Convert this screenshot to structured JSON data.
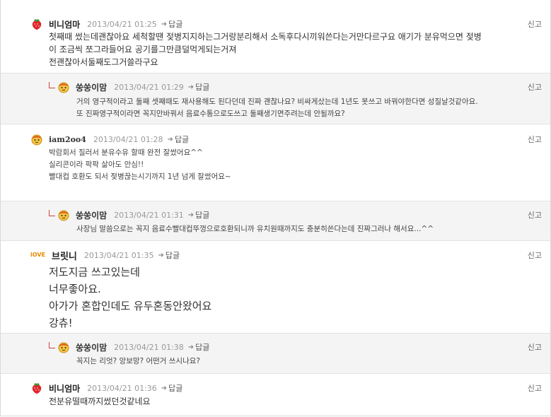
{
  "comments": [
    {
      "nickname": "비니엄마",
      "date": "2013/04/21 01:25",
      "reply_label": "답글",
      "report_label": "신고",
      "avatar_icon": "strawberry-icon",
      "body": "첫째때 썼는데괜찮아요 세척할땐 젖병지지하는그거랑분리해서 소독후다시끼워쓴다는거만다르구요 애기가 분유먹으면 젖병\n이 조금씩 쪼그라들어요 공기를그만큼덜먹게되는거져\n전괜찮아서둘째도그거쓸라구요"
    },
    {
      "nickname": "쑹쑹이맘",
      "date": "2013/04/21 01:29",
      "reply_label": "답글",
      "report_label": "신고",
      "avatar_icon": "mascot-icon",
      "body": "거의 영구적이라고 둘째 셋째때도 재사용해도 된다던데 진짜 괜찮나요? 비싸게샀는데 1년도 못쓰고 바꿔야한다면 성질날것같아요.\n또 진짜영구적이라면 꼭지만바꿔서 음료수통으로도쓰고 둘째생기면주려는데 안될까요?"
    },
    {
      "nickname": "iam2oo4",
      "date": "2013/04/21 01:28",
      "reply_label": "답글",
      "report_label": "신고",
      "avatar_icon": "mascot-icon",
      "body": "박람회서 질러서 분유수유 할때 완전 잘썼어요^^\n실리콘이라 팍팍 삶아도 안심!!\n빨대컵 호환도 되서 젖병끊는시기까지 1년 넘게 잘썼어요~"
    },
    {
      "nickname": "쑹쑹이맘",
      "date": "2013/04/21 01:31",
      "reply_label": "답글",
      "report_label": "신고",
      "avatar_icon": "mascot-icon",
      "body": "사장님 말씀으로는 꼭지 음료수빨대컵뚜껑으로호환되니까 유치원때까지도 충분히쓴다는데 진짜그러나 해서요...^^"
    },
    {
      "nickname": "브릿니",
      "date": "2013/04/21 01:35",
      "reply_label": "답글",
      "report_label": "신고",
      "avatar_icon": "love-badge-icon",
      "avatar_text": "lOVE",
      "body": "저도지금 쓰고있는데\n너무좋아요.\n아가가 혼합인데도 유두혼동안왔어요\n강츄!"
    },
    {
      "nickname": "쑹쑹이맘",
      "date": "2013/04/21 01:38",
      "reply_label": "답글",
      "report_label": "신고",
      "avatar_icon": "mascot-icon",
      "body": "꼭지는 리엇? 앙보망? 어떤거 쓰시나요?"
    },
    {
      "nickname": "비니엄마",
      "date": "2013/04/21 01:36",
      "reply_label": "답글",
      "report_label": "신고",
      "avatar_icon": "strawberry-icon",
      "body": "전분유떨때까지썼던것같네요"
    }
  ]
}
